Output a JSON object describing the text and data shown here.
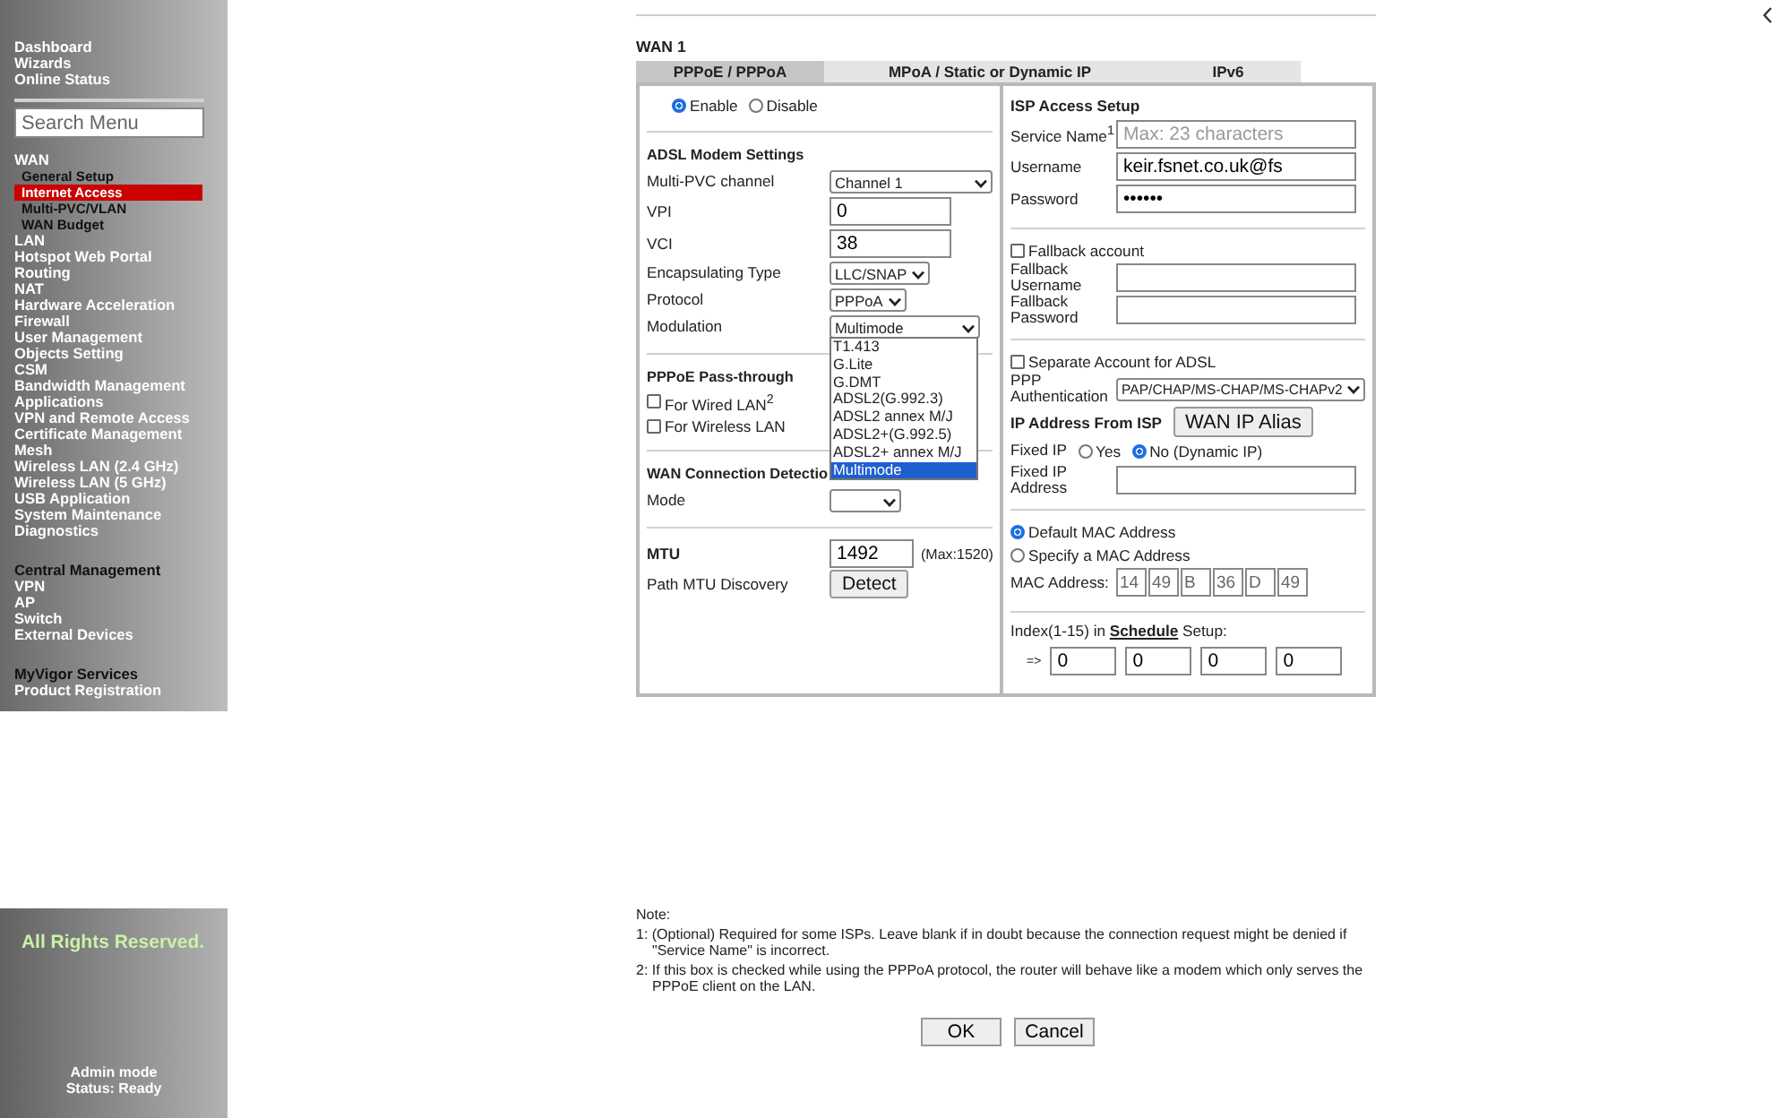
{
  "sidebar": {
    "top_links": [
      {
        "label": "Dashboard",
        "selected": false
      },
      {
        "label": "Wizards",
        "selected": false
      },
      {
        "label": "Online Status",
        "selected": false
      }
    ],
    "search": {
      "placeholder": "Search Menu"
    },
    "sections": [
      [
        {
          "label": "WAN",
          "kind": "main",
          "selected": false
        },
        {
          "label": "General Setup",
          "kind": "sub",
          "selected": false
        },
        {
          "label": "Internet Access",
          "kind": "sub",
          "selected": true
        },
        {
          "label": "Multi-PVC/VLAN",
          "kind": "sub",
          "selected": false
        },
        {
          "label": "WAN Budget",
          "kind": "sub",
          "selected": false
        },
        {
          "label": "LAN",
          "kind": "main",
          "selected": false
        },
        {
          "label": "Hotspot Web Portal",
          "kind": "main",
          "selected": false
        },
        {
          "label": "Routing",
          "kind": "main",
          "selected": false
        },
        {
          "label": "NAT",
          "kind": "main",
          "selected": false
        },
        {
          "label": "Hardware Acceleration",
          "kind": "main",
          "selected": false
        },
        {
          "label": "Firewall",
          "kind": "main",
          "selected": false
        },
        {
          "label": "User Management",
          "kind": "main",
          "selected": false
        },
        {
          "label": "Objects Setting",
          "kind": "main",
          "selected": false
        },
        {
          "label": "CSM",
          "kind": "main",
          "selected": false
        },
        {
          "label": "Bandwidth Management",
          "kind": "main",
          "selected": false
        },
        {
          "label": "Applications",
          "kind": "main",
          "selected": false
        },
        {
          "label": "VPN and Remote Access",
          "kind": "main",
          "selected": false
        },
        {
          "label": "Certificate Management",
          "kind": "main",
          "selected": false
        },
        {
          "label": "Mesh",
          "kind": "main",
          "selected": false
        },
        {
          "label": "Wireless LAN (2.4 GHz)",
          "kind": "main",
          "selected": false
        },
        {
          "label": "Wireless LAN (5 GHz)",
          "kind": "main",
          "selected": false
        },
        {
          "label": "USB Application",
          "kind": "main",
          "selected": false
        },
        {
          "label": "System Maintenance",
          "kind": "main",
          "selected": false
        },
        {
          "label": "Diagnostics",
          "kind": "main",
          "selected": false
        }
      ],
      [
        {
          "label": "Central Management",
          "kind": "header",
          "selected": false
        },
        {
          "label": "VPN",
          "kind": "main",
          "selected": false
        },
        {
          "label": "AP",
          "kind": "main",
          "selected": false
        },
        {
          "label": "Switch",
          "kind": "main",
          "selected": false
        },
        {
          "label": "External Devices",
          "kind": "main",
          "selected": false
        }
      ],
      [
        {
          "label": "MyVigor Services",
          "kind": "header",
          "selected": false
        },
        {
          "label": "Product Registration",
          "kind": "main",
          "selected": false
        }
      ]
    ],
    "footer": {
      "copyright": "All Rights Reserved.",
      "mode": "Admin mode",
      "status": "Status: Ready"
    }
  },
  "main": {
    "title": "WAN 1",
    "tabs": [
      {
        "label": "PPPoE / PPPoA",
        "selected": true
      },
      {
        "label": "MPoA / Static or Dynamic IP",
        "selected": false
      },
      {
        "label": "IPv6",
        "selected": false
      }
    ],
    "left": [
      {
        "kind": "radios",
        "options": [
          {
            "label": "Enable",
            "selected": true
          },
          {
            "label": "Disable",
            "selected": false
          }
        ]
      },
      {
        "kind": "divider"
      },
      {
        "kind": "heading",
        "text": "ADSL Modem Settings"
      },
      {
        "kind": "select",
        "label": "Multi-PVC channel",
        "value": "Channel 1"
      },
      {
        "kind": "input",
        "label": "VPI",
        "value": "0"
      },
      {
        "kind": "input",
        "label": "VCI",
        "value": "38"
      },
      {
        "kind": "select",
        "label": "Encapsulating Type",
        "value": "LLC/SNAP"
      },
      {
        "kind": "select",
        "label": "Protocol",
        "value": "PPPoA"
      },
      {
        "kind": "select",
        "label": "Modulation",
        "value": "Multimode",
        "expanded": true,
        "options": [
          {
            "label": "T1.413",
            "selected": false
          },
          {
            "label": "G.Lite",
            "selected": false
          },
          {
            "label": "G.DMT",
            "selected": false
          },
          {
            "label": "ADSL2(G.992.3)",
            "selected": false
          },
          {
            "label": "ADSL2 annex M/J",
            "selected": false
          },
          {
            "label": "ADSL2+(G.992.5)",
            "selected": false
          },
          {
            "label": "ADSL2+ annex M/J",
            "selected": false
          },
          {
            "label": "Multimode",
            "selected": true
          }
        ]
      },
      {
        "kind": "divider"
      },
      {
        "kind": "heading",
        "text": "PPPoE Pass-through"
      },
      {
        "kind": "checkbox",
        "label": "For Wired LAN$^{2}$",
        "checked": false
      },
      {
        "kind": "checkbox",
        "label": "For Wireless LAN",
        "checked": false
      },
      {
        "kind": "divider"
      },
      {
        "kind": "heading",
        "text": "WAN Connection Detectio"
      },
      {
        "kind": "select",
        "label": "Mode"
      },
      {
        "kind": "divider"
      },
      {
        "kind": "heading-input",
        "label": "MTU",
        "value": "1492",
        "note": "(Max:1520)"
      },
      {
        "kind": "button",
        "label": "Path MTU Discovery",
        "button": "Detect"
      }
    ],
    "right": [
      {
        "kind": "heading",
        "text": "ISP Access Setup"
      },
      {
        "kind": "input",
        "label": "Service Name$^{1}$",
        "placeholder": "Max: 23 characters"
      },
      {
        "kind": "input",
        "label": "Username",
        "value": "keir.fsnet.co.uk@fs"
      },
      {
        "kind": "input",
        "label": "Password",
        "value": "••••••"
      },
      {
        "kind": "divider"
      },
      {
        "kind": "checkbox",
        "label": "Fallback account",
        "checked": false
      },
      {
        "kind": "input",
        "label": "Fallback Username"
      },
      {
        "kind": "input",
        "label": "Fallback Password"
      },
      {
        "kind": "divider"
      },
      {
        "kind": "checkbox",
        "label": "Separate Account for ADSL",
        "checked": false
      },
      {
        "kind": "select",
        "label": "PPP Authentication",
        "value": "PAP/CHAP/MS-CHAP/MS-CHAPv2"
      },
      {
        "kind": "heading",
        "text": "IP Address From ISP",
        "button": "WAN IP Alias"
      },
      {
        "kind": "radios",
        "label": "Fixed IP",
        "options": [
          {
            "label": "Yes",
            "selected": false
          },
          {
            "label": "No (Dynamic IP)",
            "selected": true
          }
        ]
      },
      {
        "kind": "input",
        "label": "Fixed IP Address"
      },
      {
        "kind": "divider"
      },
      {
        "kind": "radio-list",
        "options": [
          {
            "label": "Default MAC Address",
            "selected": true
          },
          {
            "label": "Specify a MAC Address",
            "selected": false
          }
        ]
      },
      {
        "kind": "mac",
        "label": "MAC Address:",
        "values": [
          "14",
          "49",
          "B",
          "36",
          "D",
          "49"
        ]
      },
      {
        "kind": "divider"
      },
      {
        "kind": "schedule",
        "prefix": "Index(1-15) in",
        "link": "Schedule",
        "suffix": "Setup:",
        "arrow": "=>",
        "values": [
          "0",
          "0",
          "0",
          "0"
        ]
      }
    ],
    "notes": {
      "title": "Note:",
      "items": [
        "1: (Optional) Required for some ISPs. Leave blank if in doubt because the connection request might be denied if \"Service Name\" is incorrect.",
        "2: If this box is checked while using the PPPoA protocol, the router will behave like a modem which only serves the PPPoE client on the LAN."
      ]
    },
    "buttons": [
      "OK",
      "Cancel"
    ]
  }
}
